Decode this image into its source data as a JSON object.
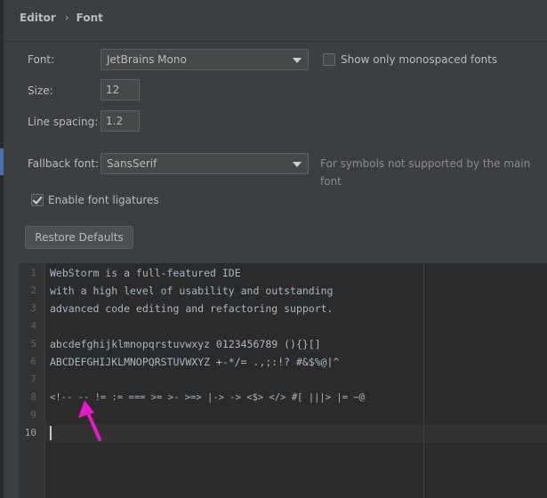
{
  "breadcrumb": {
    "parent": "Editor",
    "current": "Font"
  },
  "font": {
    "label": "Font:",
    "value": "JetBrains Mono"
  },
  "monospaced_only": {
    "label": "Show only monospaced fonts",
    "checked": false
  },
  "size": {
    "label": "Size:",
    "value": "12"
  },
  "line_spacing": {
    "label": "Line spacing:",
    "value": "1.2"
  },
  "fallback_font": {
    "label": "Fallback font:",
    "value": "SansSerif",
    "hint": "For symbols not supported by the main font"
  },
  "ligatures": {
    "label": "Enable font ligatures",
    "checked": true
  },
  "restore_defaults": {
    "label": "Restore Defaults"
  },
  "preview": {
    "lines": [
      {
        "number": "1",
        "text": "WebStorm is a full-featured IDE"
      },
      {
        "number": "2",
        "text": "with a high level of usability and outstanding"
      },
      {
        "number": "3",
        "text": "advanced code editing and refactoring support."
      },
      {
        "number": "4",
        "text": ""
      },
      {
        "number": "5",
        "text": "abcdefghijklmnopqrstuvwxyz 0123456789 (){}[]"
      },
      {
        "number": "6",
        "text": "ABCDEFGHIJKLMNOPQRSTUVWXYZ +-*/= .,;:!? #&$%@|^"
      },
      {
        "number": "7",
        "text": ""
      },
      {
        "number": "8",
        "text": "<!-- -- != := === >= >- >=> |-> -> <$> </> #[ |||> |= ~@"
      },
      {
        "number": "9",
        "text": ""
      },
      {
        "number": "10",
        "text": ""
      }
    ]
  },
  "colors": {
    "panel": "#3c3f41",
    "editor_bg": "#2b2b2b",
    "code_text": "#a9b7c6",
    "annotation_arrow": "#e619c8"
  },
  "icons": {
    "breadcrumb_separator": "chevron-right-icon",
    "combo_arrow": "chevron-down-icon",
    "annotation": "arrow-annotation-icon"
  }
}
